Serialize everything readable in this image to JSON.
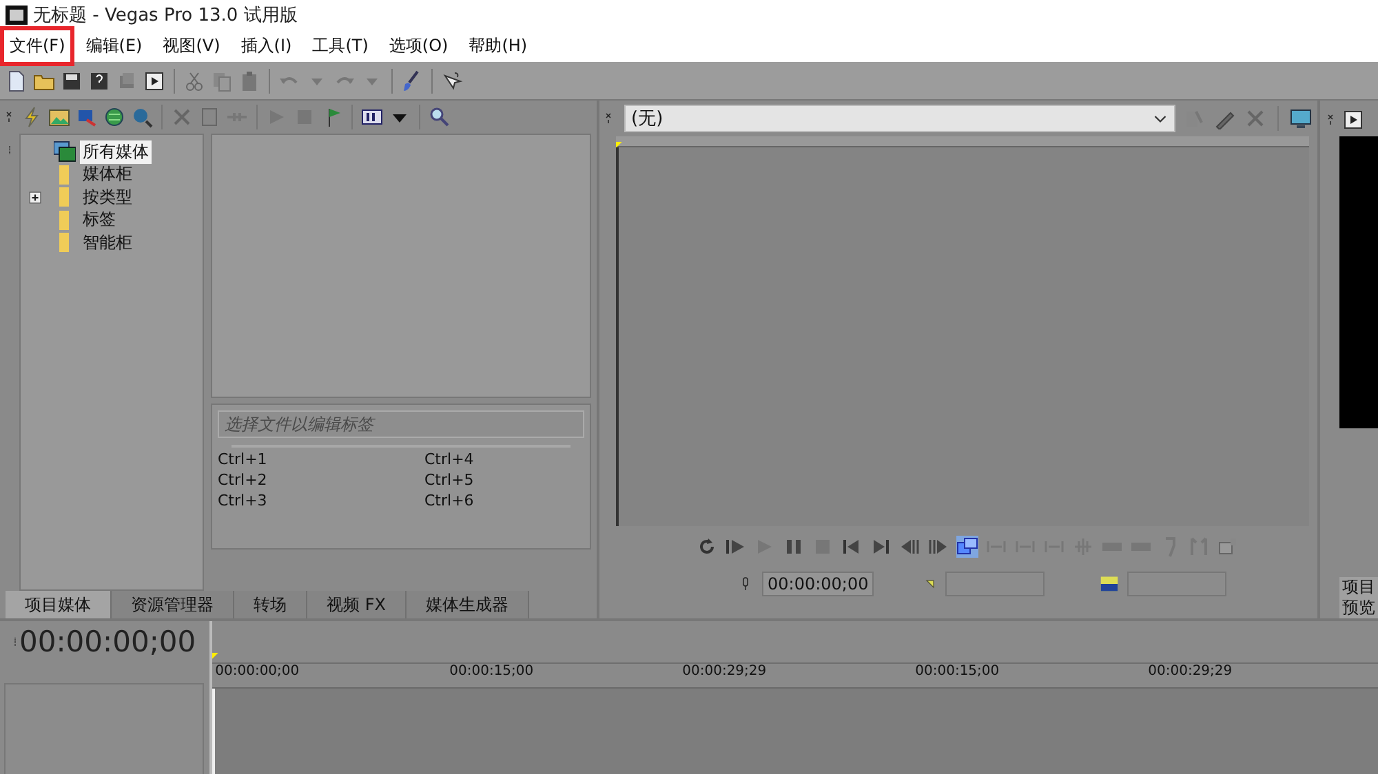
{
  "window": {
    "title": "无标题 - Vegas Pro 13.0 试用版"
  },
  "menu": [
    {
      "label": "文件(F)",
      "highlighted": true
    },
    {
      "label": "编辑(E)",
      "highlighted": false
    },
    {
      "label": "视图(V)",
      "highlighted": false
    },
    {
      "label": "插入(I)",
      "highlighted": false
    },
    {
      "label": "工具(T)",
      "highlighted": false
    },
    {
      "label": "选项(O)",
      "highlighted": false
    },
    {
      "label": "帮助(H)",
      "highlighted": false
    }
  ],
  "media_tree": [
    {
      "label": "所有媒体",
      "kind": "all",
      "selected": true
    },
    {
      "label": "媒体柜",
      "kind": "folder",
      "selected": false
    },
    {
      "label": "按类型",
      "kind": "folder",
      "selected": false,
      "expanded": false
    },
    {
      "label": "标签",
      "kind": "folder",
      "selected": false
    },
    {
      "label": "智能柜",
      "kind": "folder",
      "selected": false
    }
  ],
  "tag_panel": {
    "placeholder": "选择文件以编辑标签",
    "shortcuts": [
      "Ctrl+1",
      "Ctrl+4",
      "Ctrl+2",
      "Ctrl+5",
      "Ctrl+3",
      "Ctrl+6"
    ]
  },
  "tabs": [
    {
      "label": "项目媒体",
      "selected": true
    },
    {
      "label": "资源管理器",
      "selected": false
    },
    {
      "label": "转场",
      "selected": false
    },
    {
      "label": "视频 FX",
      "selected": false
    },
    {
      "label": "媒体生成器",
      "selected": false
    }
  ],
  "preview": {
    "mode": "(无)",
    "timecode": "00:00:00;00"
  },
  "side_panel": {
    "tab_label": "项目预览"
  },
  "timeline": {
    "timecode": "00:00:00;00",
    "ruler": [
      "00:00:00;00",
      "00:00:15;00",
      "00:00:29;29",
      "00:00:15;00",
      "00:00:29;29"
    ]
  }
}
